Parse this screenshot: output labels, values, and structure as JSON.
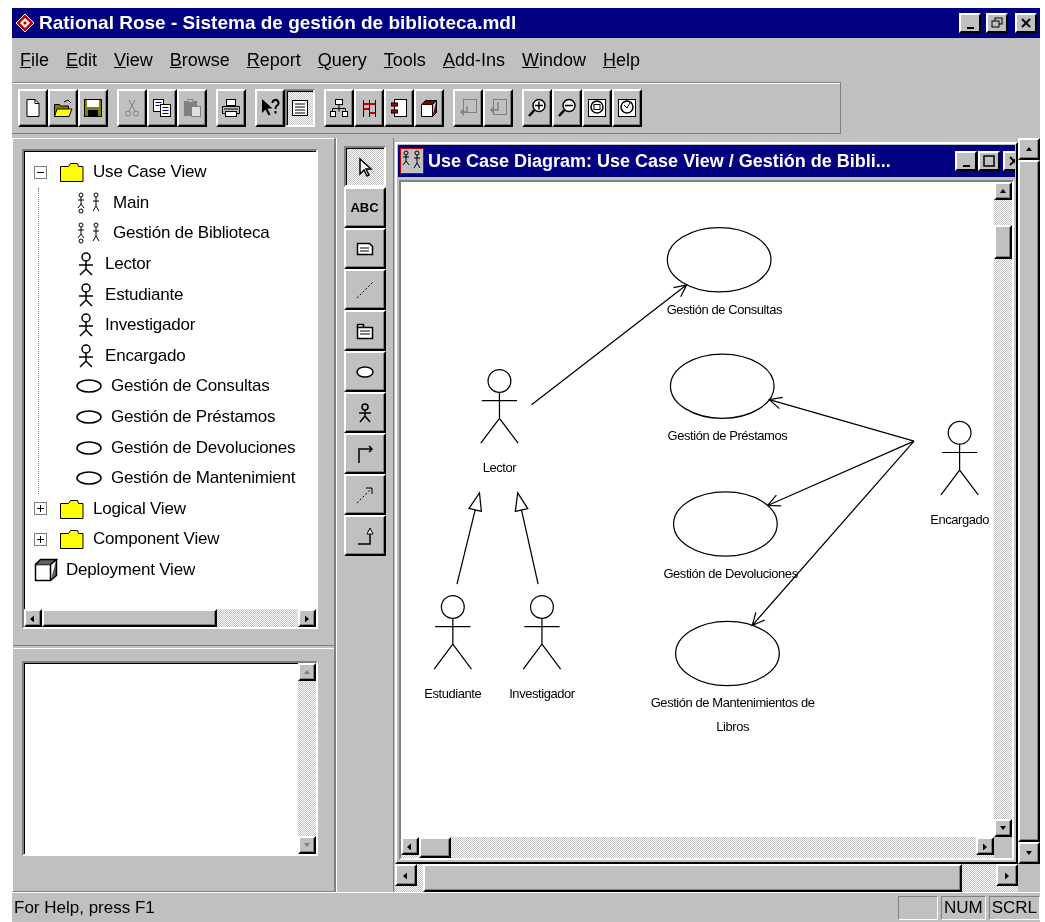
{
  "window": {
    "title": "Rational Rose - Sistema de gestión de biblioteca.mdl"
  },
  "menu": [
    "File",
    "Edit",
    "View",
    "Browse",
    "Report",
    "Query",
    "Tools",
    "Add-Ins",
    "Window",
    "Help"
  ],
  "toolbar": [
    [
      {
        "kind": "new",
        "disabled": false,
        "pressed": false
      },
      {
        "kind": "open",
        "disabled": false,
        "pressed": false
      },
      {
        "kind": "save",
        "disabled": false,
        "pressed": false
      }
    ],
    [
      {
        "kind": "cut",
        "disabled": true,
        "pressed": false
      },
      {
        "kind": "copy",
        "disabled": false,
        "pressed": false
      },
      {
        "kind": "paste",
        "disabled": true,
        "pressed": false
      }
    ],
    [
      {
        "kind": "print",
        "disabled": false,
        "pressed": false
      }
    ],
    [
      {
        "kind": "help",
        "disabled": false,
        "pressed": false
      },
      {
        "kind": "doc",
        "disabled": false,
        "pressed": true
      }
    ],
    [
      {
        "kind": "class",
        "disabled": false,
        "pressed": false
      },
      {
        "kind": "sequence",
        "disabled": false,
        "pressed": false
      },
      {
        "kind": "component",
        "disabled": false,
        "pressed": false
      },
      {
        "kind": "deployment",
        "disabled": false,
        "pressed": false
      }
    ],
    [
      {
        "kind": "previous",
        "disabled": true,
        "pressed": false
      },
      {
        "kind": "parent",
        "disabled": true,
        "pressed": false
      }
    ],
    [
      {
        "kind": "zoom_in",
        "disabled": false,
        "pressed": false
      },
      {
        "kind": "zoom_out",
        "disabled": false,
        "pressed": false
      },
      {
        "kind": "fit",
        "disabled": false,
        "pressed": false
      },
      {
        "kind": "undo_fit",
        "disabled": false,
        "pressed": false
      }
    ]
  ],
  "tree": [
    {
      "label": "Use Case View",
      "kind": "folder",
      "expanded": true,
      "children": [
        {
          "label": "Main",
          "kind": "diagram"
        },
        {
          "label": "Gestión de Biblioteca",
          "kind": "diagram"
        },
        {
          "label": "Lector",
          "kind": "actor"
        },
        {
          "label": "Estudiante",
          "kind": "actor"
        },
        {
          "label": "Investigador",
          "kind": "actor"
        },
        {
          "label": "Encargado",
          "kind": "actor"
        },
        {
          "label": "Gestión de Consultas",
          "kind": "use_case"
        },
        {
          "label": "Gestión de Préstamos",
          "kind": "use_case"
        },
        {
          "label": "Gestión de Devoluciones",
          "kind": "use_case"
        },
        {
          "label": "Gestión de Mantenimient",
          "kind": "use_case"
        }
      ]
    },
    {
      "label": "Logical View",
      "kind": "folder",
      "expanded": false
    },
    {
      "label": "Component View",
      "kind": "folder",
      "expanded": false
    },
    {
      "label": "Deployment View",
      "kind": "node"
    }
  ],
  "toolbox": [
    {
      "kind": "pointer",
      "selected": true
    },
    {
      "kind": "text",
      "label": "ABC",
      "selected": false
    },
    {
      "kind": "note",
      "selected": false
    },
    {
      "kind": "anchor",
      "selected": false
    },
    {
      "kind": "package",
      "selected": false
    },
    {
      "kind": "use_case",
      "selected": false
    },
    {
      "kind": "actor",
      "selected": false
    },
    {
      "kind": "association",
      "selected": false
    },
    {
      "kind": "dependency",
      "selected": false
    },
    {
      "kind": "generalization",
      "selected": false
    }
  ],
  "diagram": {
    "title": "Use Case Diagram: Use Case View / Gestión de Bibli...",
    "actors": [
      {
        "name": "Lector"
      },
      {
        "name": "Estudiante"
      },
      {
        "name": "Investigador"
      },
      {
        "name": "Encargado"
      }
    ],
    "use_cases": [
      {
        "name": "Gestión de Consultas"
      },
      {
        "name": "Gestión de Préstamos"
      },
      {
        "name": "Gestión de Devoluciones"
      },
      {
        "name": "Gestión de Mantenimientos de Libros"
      }
    ]
  },
  "status_bar": {
    "message": "For Help, press F1",
    "indicators": [
      "NUM",
      "SCRL"
    ]
  }
}
